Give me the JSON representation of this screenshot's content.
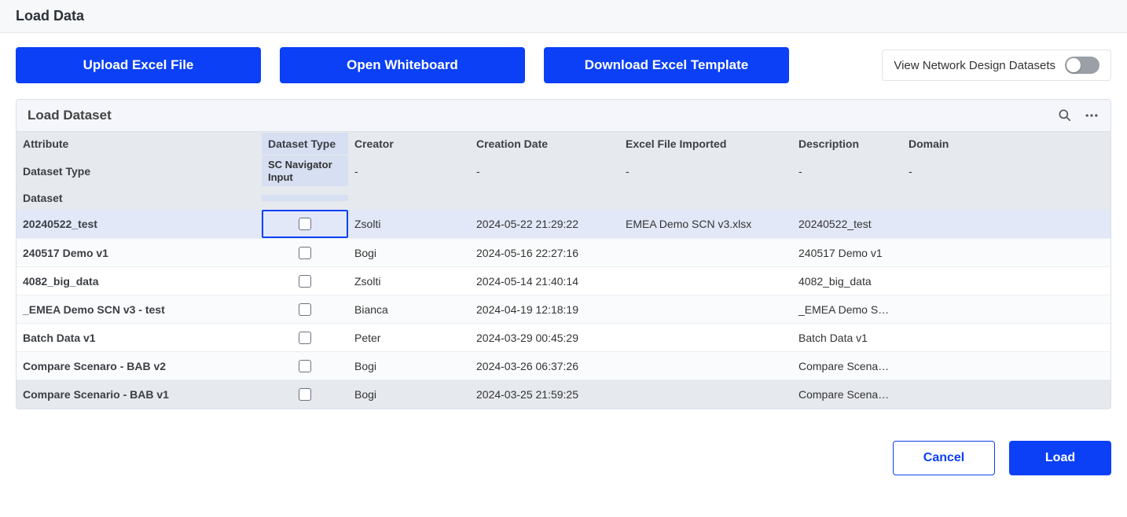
{
  "header": {
    "title": "Load Data"
  },
  "actions": {
    "upload_label": "Upload Excel File",
    "whiteboard_label": "Open Whiteboard",
    "download_label": "Download Excel Template",
    "toggle_label": "View Network Design Datasets"
  },
  "card": {
    "title": "Load Dataset",
    "columns": {
      "attribute": "Attribute",
      "dataset_type": "Dataset Type",
      "creator": "Creator",
      "creation_date": "Creation Date",
      "excel_imported": "Excel File Imported",
      "description": "Description",
      "domain": "Domain"
    },
    "subheader": {
      "attribute": "Dataset Type",
      "dataset_type_value": "SC Navigator Input",
      "creator": "-",
      "creation_date": "-",
      "excel_imported": "-",
      "description": "-",
      "domain": "-"
    },
    "subheader2": {
      "attribute": "Dataset"
    }
  },
  "rows": [
    {
      "selected": true,
      "attribute": "20240522_test",
      "creator": "Zsolti",
      "date": "2024-05-22 21:29:22",
      "excel": "EMEA Demo SCN v3.xlsx",
      "desc": "20240522_test",
      "domain": ""
    },
    {
      "selected": false,
      "attribute": "240517 Demo v1",
      "creator": "Bogi",
      "date": "2024-05-16 22:27:16",
      "excel": "",
      "desc": "240517 Demo v1",
      "domain": ""
    },
    {
      "selected": false,
      "attribute": "4082_big_data",
      "creator": "Zsolti",
      "date": "2024-05-14 21:40:14",
      "excel": "",
      "desc": "4082_big_data",
      "domain": ""
    },
    {
      "selected": false,
      "attribute": "_EMEA Demo SCN v3 - test",
      "creator": "Bianca",
      "date": "2024-04-19 12:18:19",
      "excel": "",
      "desc": "_EMEA Demo S…",
      "domain": ""
    },
    {
      "selected": false,
      "attribute": "Batch Data v1",
      "creator": "Peter",
      "date": "2024-03-29 00:45:29",
      "excel": "",
      "desc": "Batch Data v1",
      "domain": ""
    },
    {
      "selected": false,
      "attribute": "Compare Scenaro - BAB v2",
      "creator": "Bogi",
      "date": "2024-03-26 06:37:26",
      "excel": "",
      "desc": "Compare Scena…",
      "domain": ""
    },
    {
      "selected": false,
      "attribute": "Compare Scenario - BAB v1",
      "creator": "Bogi",
      "date": "2024-03-25 21:59:25",
      "excel": "",
      "desc": "Compare Scena…",
      "domain": ""
    }
  ],
  "footer": {
    "cancel": "Cancel",
    "load": "Load"
  }
}
